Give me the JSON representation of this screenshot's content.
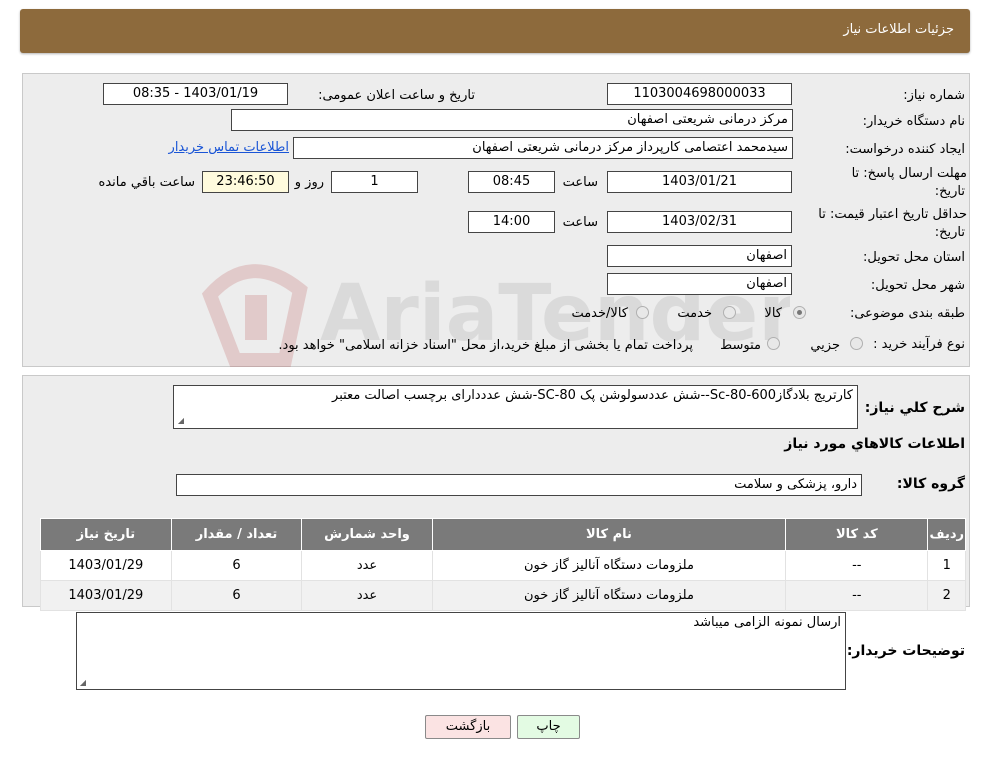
{
  "header": {
    "title": "جزئیات اطلاعات نیاز"
  },
  "info": {
    "need_number_label": "شماره نیاز:",
    "need_number": "1103004698000033",
    "announce_label": "تاریخ و ساعت اعلان عمومی:",
    "announce_value": "1403/01/19 - 08:35",
    "buyer_org_label": "نام دستگاه خریدار:",
    "buyer_org": "مرکز درمانی شریعتی اصفهان",
    "creator_label": "ایجاد کننده درخواست:",
    "creator": "سیدمحمد اعتصامی کارپرداز مرکز درمانی شریعتی اصفهان",
    "contact_link": "اطلاعات تماس خریدار",
    "deadline_label_1": "مهلت ارسال پاسخ: تا",
    "deadline_label_2": "تاریخ:",
    "deadline_date": "1403/01/21",
    "time_label": "ساعت",
    "deadline_time": "08:45",
    "days_value": "1",
    "days_label": "روز و",
    "remaining_time": "23:46:50",
    "remaining_label": "ساعت باقي مانده",
    "validity_label_1": "حداقل تاریخ اعتبار قیمت: تا",
    "validity_label_2": "تاریخ:",
    "validity_date": "1403/02/31",
    "validity_time": "14:00",
    "province_label": "استان محل تحویل:",
    "province": "اصفهان",
    "city_label": "شهر محل تحویل:",
    "city": "اصفهان",
    "category_label": "طبقه بندی موضوعی:",
    "category_options": [
      "کالا",
      "خدمت",
      "کالا/خدمت"
    ],
    "category_selected": "کالا",
    "process_label": "نوع فرآیند خرید :",
    "process_options": [
      "جزیي",
      "متوسط"
    ],
    "process_note": "پرداخت تمام یا بخشی از مبلغ خرید،از محل \"اسناد خزانه اسلامی\" خواهد بود."
  },
  "description": {
    "label": "شرح کلي نياز:",
    "text": "کارتریج بلادگاز600-80-Sc--شش عددسولوشن پک SC-80-شش عدددارای برچسب اصالت معتبر",
    "goods_info_title": "اطلاعات کالاهاي مورد نياز",
    "goods_group_label": "گروه کالا:",
    "goods_group": "دارو، پزشکی و سلامت"
  },
  "table": {
    "headers": [
      "رديف",
      "کد کالا",
      "نام کالا",
      "واحد شمارش",
      "تعداد / مقدار",
      "تاريخ نياز"
    ],
    "rows": [
      [
        "1",
        "--",
        "ملزومات دستگاه آنالیز گاز خون",
        "عدد",
        "6",
        "1403/01/29"
      ],
      [
        "2",
        "--",
        "ملزومات دستگاه آنالیز گاز خون",
        "عدد",
        "6",
        "1403/01/29"
      ]
    ]
  },
  "buyer_notes": {
    "label": "توضیحات خریدار:",
    "text": "ارسال نمونه الزامی میباشد"
  },
  "buttons": {
    "print": "چاپ",
    "back": "بازگشت"
  },
  "colors": {
    "header": "#8d6a3c",
    "panel": "#ededed",
    "table_header": "#7a7a7a",
    "back_button": "#fbe3e3",
    "print_button": "#e3fbe3"
  }
}
